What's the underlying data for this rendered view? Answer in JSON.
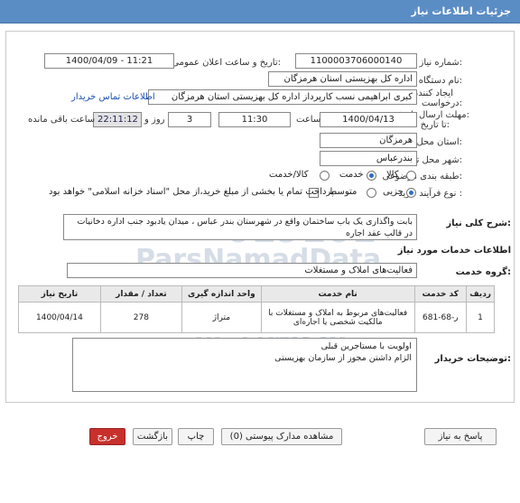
{
  "header": {
    "title": "جزئیات اطلاعات نیاز"
  },
  "fields": {
    "need_number_label": "شماره نیاز:",
    "need_number": "1100003706000140",
    "announce_label": "تاریخ و ساعت اعلان عمومی:",
    "announce_value": "1400/04/09 - 11:21",
    "buyer_label": "نام دستگاه خریدار:",
    "buyer_value": "اداره کل بهزیستی استان هرمزگان",
    "creator_label_1": "ایجاد کننده",
    "creator_label_2": "درخواست:",
    "creator_value": "کبری  ابراهیمی نسب کارپرداز اداره کل بهزیستی استان هرمزگان",
    "contact_link": "اطلاعات تماس خریدار",
    "deadline_label_1": "مهلت ارسال پاسخ:",
    "deadline_label_2": "تا تاریخ:",
    "deadline_date": "1400/04/13",
    "time_label": "ساعت",
    "deadline_time": "11:30",
    "days_value": "3",
    "days_label": "روز و",
    "remaining_time": "22:11:12",
    "remaining_label": "ساعت باقی مانده",
    "province_label": "استان محل تحویل:",
    "province_value": "هرمزگان",
    "city_label": "شهر محل تحویل:",
    "city_value": "بندرعباس",
    "category_label": "طبقه بندی موضوعی:",
    "category_options": [
      "کالا",
      "خدمت",
      "کالا/خدمت"
    ],
    "process_label": "نوع فرآیند خرید :",
    "process_options": [
      "جزیی",
      "متوسط"
    ],
    "payment_text": "پرداخت تمام یا بخشی از مبلغ خرید،از محل \"اسناد خزانه اسلامی\" خواهد بود."
  },
  "description": {
    "label": "شرح کلی نیاز:",
    "text": "بابت واگذاری یک باب ساختمان  واقع در شهرستان بندر عباس ، میدان یادبود جنب اداره دخانیات در قالب عقد اجاره"
  },
  "services": {
    "section_title": "اطلاعات خدمات مورد نیاز",
    "group_label": "گروه خدمت:",
    "group_value": "فعالیت‌های  املاک و مستغلات",
    "columns": [
      "ردیف",
      "کد خدمت",
      "نام خدمت",
      "واحد اندازه گیری",
      "تعداد / مقدار",
      "تاریخ نیاز"
    ],
    "rows": [
      {
        "row": "1",
        "code": "ر-68-681",
        "name": "فعالیت‌های مربوط به املاک و مستغلات با مالکیت شخصی یا اجاره‌ای",
        "unit": "متراژ",
        "qty": "278",
        "date": "1400/04/14"
      }
    ]
  },
  "notes": {
    "label": "توضیحات خریدار:",
    "line1": "اولویت با مستاجرین قبلی",
    "line2": "الزام داشتن مجوز از سازمان بهزیستی"
  },
  "watermark": {
    "top": "019101",
    "brand": "ParsNamadData",
    "phone": "۰۲۱-۸۸۳۴۹۶۷۰"
  },
  "buttons": {
    "reply": "پاسخ به نیاز",
    "docs": "مشاهده مدارک پیوستی (0)",
    "print": "چاپ",
    "back": "بازگشت",
    "exit": "خروج"
  },
  "colors": {
    "header": "#5b8dc5",
    "exit_button": "#c8302b",
    "link": "#1a4fb3"
  }
}
